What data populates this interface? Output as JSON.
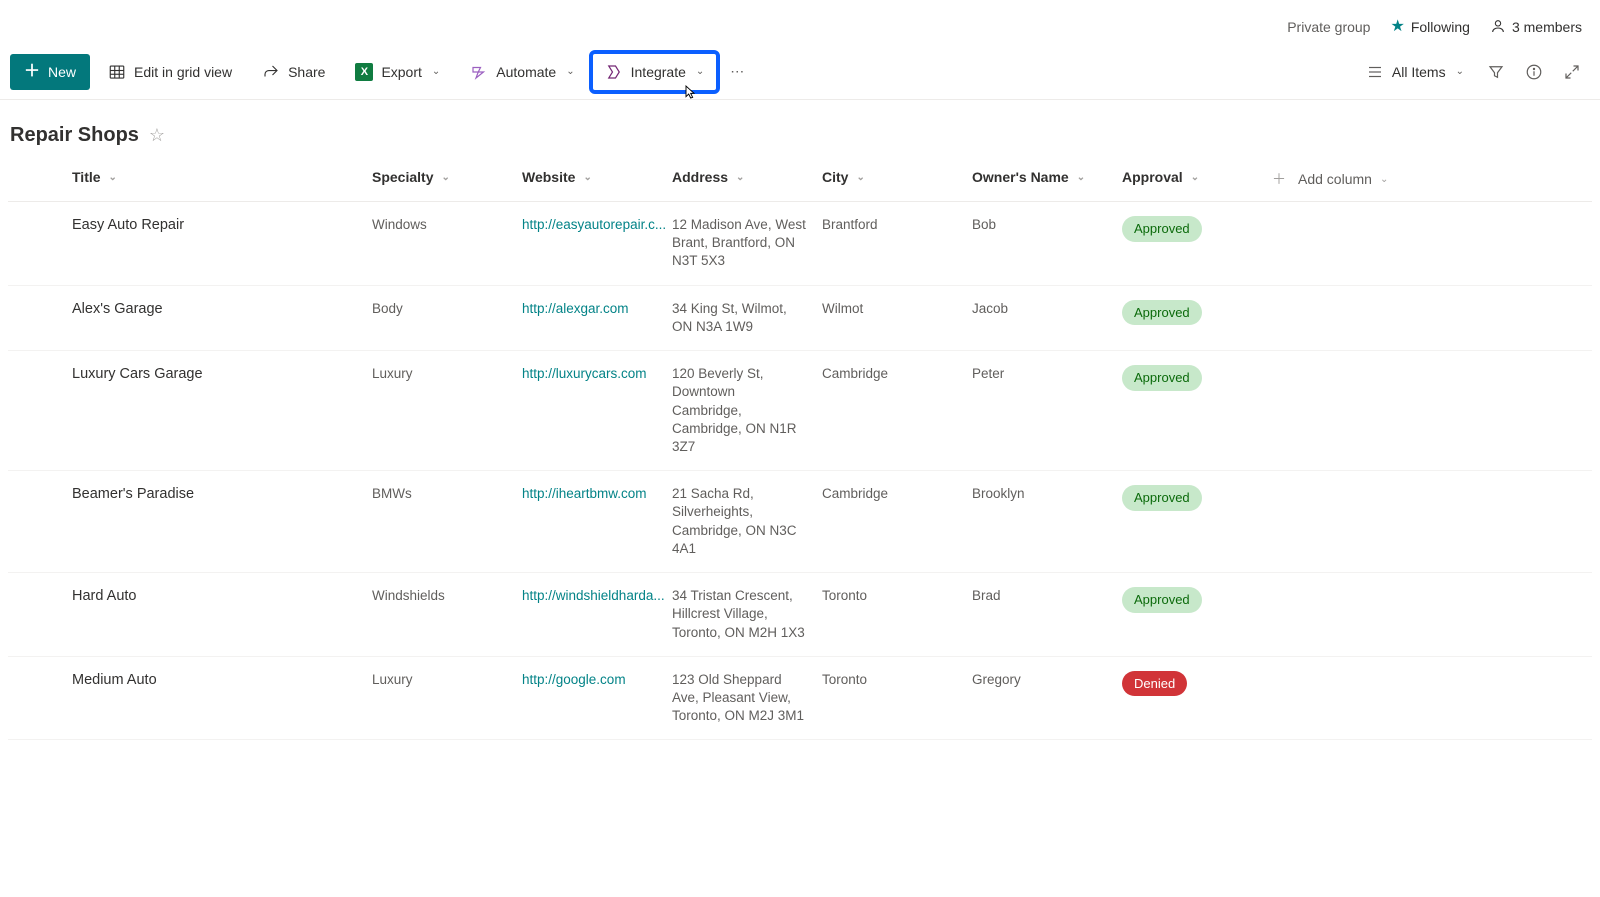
{
  "header": {
    "private_group": "Private group",
    "following": "Following",
    "members": "3 members"
  },
  "commands": {
    "new": "New",
    "edit_grid": "Edit in grid view",
    "share": "Share",
    "export": "Export",
    "automate": "Automate",
    "integrate": "Integrate",
    "all_items": "All Items"
  },
  "list": {
    "title": "Repair Shops"
  },
  "columns": {
    "title": "Title",
    "specialty": "Specialty",
    "website": "Website",
    "address": "Address",
    "city": "City",
    "owner": "Owner's Name",
    "approval": "Approval",
    "add_column": "Add column"
  },
  "rows": [
    {
      "title": "Easy Auto Repair",
      "specialty": "Windows",
      "website": "http://easyautorepair.c...",
      "address": "12 Madison Ave, West Brant, Brantford, ON N3T 5X3",
      "city": "Brantford",
      "owner": "Bob",
      "approval": "Approved",
      "approval_class": "approved"
    },
    {
      "title": "Alex's Garage",
      "specialty": "Body",
      "website": "http://alexgar.com",
      "address": "34 King St, Wilmot, ON N3A 1W9",
      "city": "Wilmot",
      "owner": "Jacob",
      "approval": "Approved",
      "approval_class": "approved"
    },
    {
      "title": "Luxury Cars Garage",
      "specialty": "Luxury",
      "website": "http://luxurycars.com",
      "address": "120 Beverly St, Downtown Cambridge, Cambridge, ON N1R 3Z7",
      "city": "Cambridge",
      "owner": "Peter",
      "approval": "Approved",
      "approval_class": "approved"
    },
    {
      "title": "Beamer's Paradise",
      "specialty": "BMWs",
      "website": "http://iheartbmw.com",
      "address": "21 Sacha Rd, Silverheights, Cambridge, ON N3C 4A1",
      "city": "Cambridge",
      "owner": "Brooklyn",
      "approval": "Approved",
      "approval_class": "approved"
    },
    {
      "title": "Hard Auto",
      "specialty": "Windshields",
      "website": "http://windshieldharda...",
      "address": "34 Tristan Crescent, Hillcrest Village, Toronto, ON M2H 1X3",
      "city": "Toronto",
      "owner": "Brad",
      "approval": "Approved",
      "approval_class": "approved"
    },
    {
      "title": "Medium Auto",
      "specialty": "Luxury",
      "website": "http://google.com",
      "address": "123 Old Sheppard Ave, Pleasant View, Toronto, ON M2J 3M1",
      "city": "Toronto",
      "owner": "Gregory",
      "approval": "Denied",
      "approval_class": "denied"
    }
  ]
}
